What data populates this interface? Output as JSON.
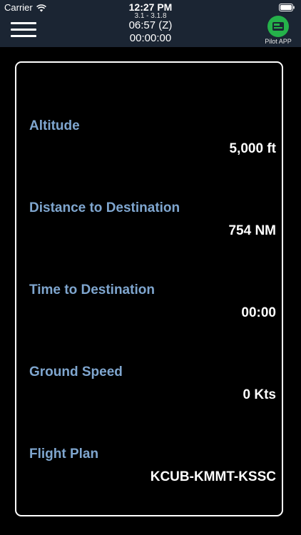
{
  "status_bar": {
    "carrier": "Carrier",
    "time": "12:27 PM"
  },
  "header": {
    "version": "3.1 - 3.1.8",
    "zulu_time": "06:57 (Z)",
    "elapsed": "00:00:00",
    "pilot_app_label": "Pilot APP"
  },
  "metrics": [
    {
      "label": "Altitude",
      "value": "5,000 ft"
    },
    {
      "label": "Distance to Destination",
      "value": "754 NM"
    },
    {
      "label": "Time to Destination",
      "value": "00:00"
    },
    {
      "label": "Ground Speed",
      "value": "0 Kts"
    },
    {
      "label": "Flight Plan",
      "value": "KCUB-KMMT-KSSC"
    }
  ],
  "colors": {
    "header_bg": "#1b2533",
    "label": "#7fa6cf",
    "pilot_badge": "#25b14a"
  },
  "icons": [
    "wifi-icon",
    "battery-icon",
    "menu-icon",
    "pilot-app-icon"
  ]
}
